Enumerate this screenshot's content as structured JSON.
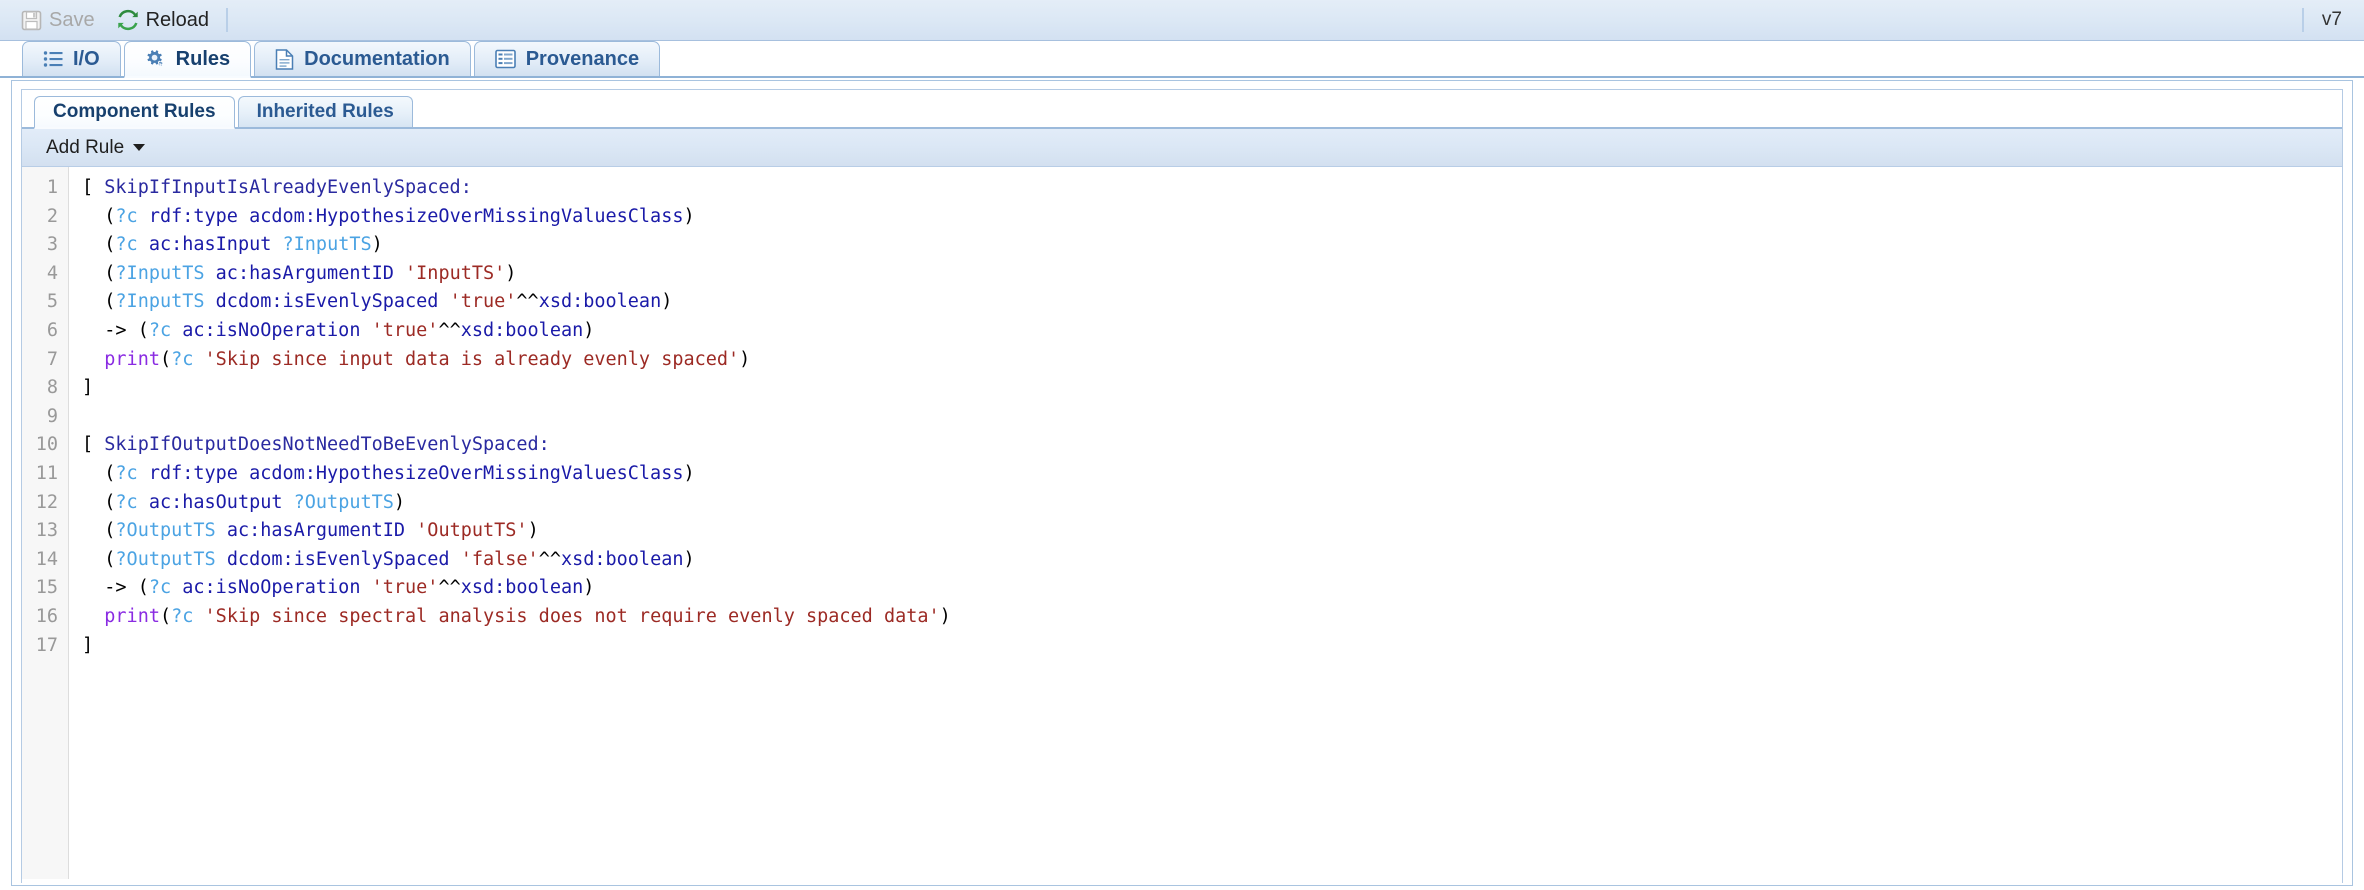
{
  "toolbar": {
    "save_label": "Save",
    "save_icon": "floppy-disk-icon",
    "save_disabled": true,
    "reload_label": "Reload",
    "reload_icon": "refresh-icon",
    "version_label": "v7"
  },
  "tabs": [
    {
      "label": "I/O",
      "icon": "list-icon",
      "active": false
    },
    {
      "label": "Rules",
      "icon": "gears-icon",
      "active": true
    },
    {
      "label": "Documentation",
      "icon": "document-icon",
      "active": false
    },
    {
      "label": "Provenance",
      "icon": "table-icon",
      "active": false
    }
  ],
  "subtabs": [
    {
      "label": "Component Rules",
      "active": true
    },
    {
      "label": "Inherited Rules",
      "active": false
    }
  ],
  "actionbar": {
    "add_rule_label": "Add Rule",
    "caret_icon": "caret-down-icon"
  },
  "editor": {
    "line_count": 17,
    "line_numbers": [
      "1",
      "2",
      "3",
      "4",
      "5",
      "6",
      "7",
      "8",
      "9",
      "10",
      "11",
      "12",
      "13",
      "14",
      "15",
      "16",
      "17"
    ],
    "lines": [
      [
        {
          "t": "[ ",
          "c": "t-punc"
        },
        {
          "t": "SkipIfInputIsAlreadyEvenlySpaced:",
          "c": "t-name"
        }
      ],
      [
        {
          "t": "  (",
          "c": "t-punc"
        },
        {
          "t": "?c",
          "c": "t-var"
        },
        {
          "t": " ",
          "c": "t-punc"
        },
        {
          "t": "rdf:type acdom:HypothesizeOverMissingValuesClass",
          "c": "t-pred"
        },
        {
          "t": ")",
          "c": "t-punc"
        }
      ],
      [
        {
          "t": "  (",
          "c": "t-punc"
        },
        {
          "t": "?c",
          "c": "t-var"
        },
        {
          "t": " ",
          "c": "t-punc"
        },
        {
          "t": "ac:hasInput",
          "c": "t-pred"
        },
        {
          "t": " ",
          "c": "t-punc"
        },
        {
          "t": "?InputTS",
          "c": "t-var"
        },
        {
          "t": ")",
          "c": "t-punc"
        }
      ],
      [
        {
          "t": "  (",
          "c": "t-punc"
        },
        {
          "t": "?InputTS",
          "c": "t-var"
        },
        {
          "t": " ",
          "c": "t-punc"
        },
        {
          "t": "ac:hasArgumentID",
          "c": "t-pred"
        },
        {
          "t": " ",
          "c": "t-punc"
        },
        {
          "t": "'InputTS'",
          "c": "t-str"
        },
        {
          "t": ")",
          "c": "t-punc"
        }
      ],
      [
        {
          "t": "  (",
          "c": "t-punc"
        },
        {
          "t": "?InputTS",
          "c": "t-var"
        },
        {
          "t": " ",
          "c": "t-punc"
        },
        {
          "t": "dcdom:isEvenlySpaced",
          "c": "t-pred"
        },
        {
          "t": " ",
          "c": "t-punc"
        },
        {
          "t": "'true'",
          "c": "t-str"
        },
        {
          "t": "^^",
          "c": "t-punc"
        },
        {
          "t": "xsd:boolean",
          "c": "t-pred"
        },
        {
          "t": ")",
          "c": "t-punc"
        }
      ],
      [
        {
          "t": "  -> (",
          "c": "t-punc"
        },
        {
          "t": "?c",
          "c": "t-var"
        },
        {
          "t": " ",
          "c": "t-punc"
        },
        {
          "t": "ac:isNoOperation",
          "c": "t-pred"
        },
        {
          "t": " ",
          "c": "t-punc"
        },
        {
          "t": "'true'",
          "c": "t-str"
        },
        {
          "t": "^^",
          "c": "t-punc"
        },
        {
          "t": "xsd:boolean",
          "c": "t-pred"
        },
        {
          "t": ")",
          "c": "t-punc"
        }
      ],
      [
        {
          "t": "  ",
          "c": "t-punc"
        },
        {
          "t": "print",
          "c": "t-fn"
        },
        {
          "t": "(",
          "c": "t-punc"
        },
        {
          "t": "?c",
          "c": "t-var"
        },
        {
          "t": " ",
          "c": "t-punc"
        },
        {
          "t": "'Skip since input data is already evenly spaced'",
          "c": "t-str"
        },
        {
          "t": ")",
          "c": "t-punc"
        }
      ],
      [
        {
          "t": "]",
          "c": "t-punc"
        }
      ],
      [
        {
          "t": "",
          "c": "t-punc"
        }
      ],
      [
        {
          "t": "[ ",
          "c": "t-punc"
        },
        {
          "t": "SkipIfOutputDoesNotNeedToBeEvenlySpaced:",
          "c": "t-name"
        }
      ],
      [
        {
          "t": "  (",
          "c": "t-punc"
        },
        {
          "t": "?c",
          "c": "t-var"
        },
        {
          "t": " ",
          "c": "t-punc"
        },
        {
          "t": "rdf:type acdom:HypothesizeOverMissingValuesClass",
          "c": "t-pred"
        },
        {
          "t": ")",
          "c": "t-punc"
        }
      ],
      [
        {
          "t": "  (",
          "c": "t-punc"
        },
        {
          "t": "?c",
          "c": "t-var"
        },
        {
          "t": " ",
          "c": "t-punc"
        },
        {
          "t": "ac:hasOutput",
          "c": "t-pred"
        },
        {
          "t": " ",
          "c": "t-punc"
        },
        {
          "t": "?OutputTS",
          "c": "t-var"
        },
        {
          "t": ")",
          "c": "t-punc"
        }
      ],
      [
        {
          "t": "  (",
          "c": "t-punc"
        },
        {
          "t": "?OutputTS",
          "c": "t-var"
        },
        {
          "t": " ",
          "c": "t-punc"
        },
        {
          "t": "ac:hasArgumentID",
          "c": "t-pred"
        },
        {
          "t": " ",
          "c": "t-punc"
        },
        {
          "t": "'OutputTS'",
          "c": "t-str"
        },
        {
          "t": ")",
          "c": "t-punc"
        }
      ],
      [
        {
          "t": "  (",
          "c": "t-punc"
        },
        {
          "t": "?OutputTS",
          "c": "t-var"
        },
        {
          "t": " ",
          "c": "t-punc"
        },
        {
          "t": "dcdom:isEvenlySpaced",
          "c": "t-pred"
        },
        {
          "t": " ",
          "c": "t-punc"
        },
        {
          "t": "'false'",
          "c": "t-str"
        },
        {
          "t": "^^",
          "c": "t-punc"
        },
        {
          "t": "xsd:boolean",
          "c": "t-pred"
        },
        {
          "t": ")",
          "c": "t-punc"
        }
      ],
      [
        {
          "t": "  -> (",
          "c": "t-punc"
        },
        {
          "t": "?c",
          "c": "t-var"
        },
        {
          "t": " ",
          "c": "t-punc"
        },
        {
          "t": "ac:isNoOperation",
          "c": "t-pred"
        },
        {
          "t": " ",
          "c": "t-punc"
        },
        {
          "t": "'true'",
          "c": "t-str"
        },
        {
          "t": "^^",
          "c": "t-punc"
        },
        {
          "t": "xsd:boolean",
          "c": "t-pred"
        },
        {
          "t": ")",
          "c": "t-punc"
        }
      ],
      [
        {
          "t": "  ",
          "c": "t-punc"
        },
        {
          "t": "print",
          "c": "t-fn"
        },
        {
          "t": "(",
          "c": "t-punc"
        },
        {
          "t": "?c",
          "c": "t-var"
        },
        {
          "t": " ",
          "c": "t-punc"
        },
        {
          "t": "'Skip since spectral analysis does not require evenly spaced data'",
          "c": "t-str"
        },
        {
          "t": ")",
          "c": "t-punc"
        }
      ],
      [
        {
          "t": "]",
          "c": "t-punc"
        }
      ]
    ],
    "plain_text": "[ SkipIfInputIsAlreadyEvenlySpaced:\n  (?c rdf:type acdom:HypothesizeOverMissingValuesClass)\n  (?c ac:hasInput ?InputTS)\n  (?InputTS ac:hasArgumentID 'InputTS')\n  (?InputTS dcdom:isEvenlySpaced 'true'^^xsd:boolean)\n  -> (?c ac:isNoOperation 'true'^^xsd:boolean)\n  print(?c 'Skip since input data is already evenly spaced')\n]\n\n[ SkipIfOutputDoesNotNeedToBeEvenlySpaced:\n  (?c rdf:type acdom:HypothesizeOverMissingValuesClass)\n  (?c ac:hasOutput ?OutputTS)\n  (?OutputTS ac:hasArgumentID 'OutputTS')\n  (?OutputTS dcdom:isEvenlySpaced 'false'^^xsd:boolean)\n  -> (?c ac:isNoOperation 'true'^^xsd:boolean)\n  print(?c 'Skip since spectral analysis does not require evenly spaced data')\n]"
  },
  "colors": {
    "accent": "#2b5a92",
    "toolbar_bg": "#dce8f5",
    "rule_name": "#2a2aa0",
    "variable": "#4ba3e3",
    "predicate": "#1a1aa8",
    "string": "#9c2a24",
    "function": "#8a2be2",
    "reload_icon": "#2e8b3e"
  }
}
